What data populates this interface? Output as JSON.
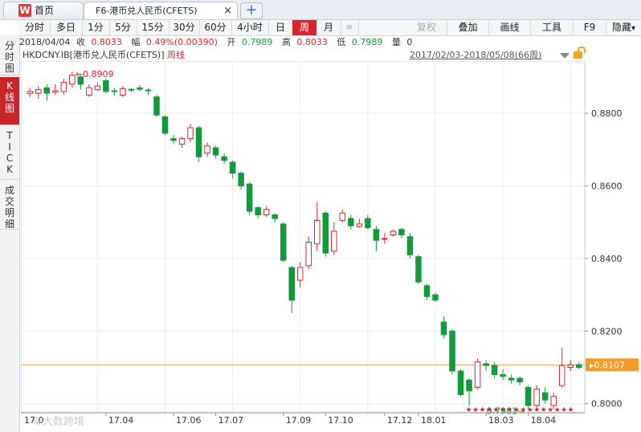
{
  "tabs": {
    "home": {
      "logo": "W",
      "label": "首页"
    },
    "active": {
      "label": "F6-港币兑人民币(CFETS)",
      "close": "×"
    },
    "new": "+"
  },
  "toolbar": {
    "items": [
      {
        "label": "分时"
      },
      {
        "label": "多日"
      },
      {
        "label": "1分"
      },
      {
        "label": "5分"
      },
      {
        "label": "15分"
      },
      {
        "label": "30分"
      },
      {
        "label": "60分"
      },
      {
        "label": "4小时"
      },
      {
        "label": "日"
      },
      {
        "label": "周",
        "selected": true
      },
      {
        "label": "月"
      },
      {
        "label": "≡",
        "icon": "list-icon"
      },
      {
        "label": "复权",
        "disabled": true
      },
      {
        "label": "叠加"
      },
      {
        "label": "画线"
      },
      {
        "label": "工具"
      },
      {
        "label": "F9"
      },
      {
        "label": "隐藏"
      }
    ],
    "dropdown_arrow": "▾"
  },
  "info": {
    "date": "2018/04/04",
    "close_label": "收",
    "close_value": "0.8033",
    "change_label": "幅",
    "change_value": "0.49%(0.00390)",
    "open_label": "开",
    "open_value": "0.7989",
    "high_label": "高",
    "high_value": "0.8033",
    "low_label": "低",
    "low_value": "0.7989",
    "vol_label": "量",
    "vol_value": "0"
  },
  "sidebar": {
    "items": [
      {
        "label": "分时图",
        "chars": [
          "分",
          "时",
          "图"
        ]
      },
      {
        "label": "K线图",
        "chars": [
          "K",
          "线",
          "图"
        ],
        "selected": true
      },
      {
        "label": "TICK",
        "chars": [
          "T",
          "I",
          "C",
          "K"
        ]
      },
      {
        "label": "成交明细",
        "chars": [
          "成",
          "交",
          "明",
          "细"
        ]
      }
    ]
  },
  "chart_title": {
    "code": "HKDCNY.IB",
    "name": "[港币兑人民币(CFETS)]",
    "period": "周线"
  },
  "range_text": "2017/02/03-2018/05/08(66周)",
  "watermark": "大数跨境",
  "colors": {
    "up": "#e0242a",
    "down": "#129b3c",
    "price_line": "#f0a25a",
    "accent": "#d9242a"
  },
  "chart_data": {
    "type": "candlestick",
    "y_ticks": [
      "0.8800",
      "0.8600",
      "0.8400",
      "0.8200",
      "0.8000"
    ],
    "y_tick_values": [
      0.88,
      0.86,
      0.84,
      0.82,
      0.8
    ],
    "ylim": [
      0.7975,
      0.8935
    ],
    "x_ticks": [
      {
        "label": "17.04",
        "index": 9
      },
      {
        "label": "17.06",
        "index": 17
      },
      {
        "label": "17.07",
        "index": 22
      },
      {
        "label": "17.09",
        "index": 30
      },
      {
        "label": "17.10",
        "index": 35
      },
      {
        "label": "17.12",
        "index": 42
      },
      {
        "label": "18.01",
        "index": 46
      },
      {
        "label": "18.03",
        "index": 54
      },
      {
        "label": "18.04",
        "index": 59
      }
    ],
    "x_tick_first": "17.0",
    "current_price": "0.8107",
    "current_price_value": 0.8107,
    "high_annotation": {
      "label": "←0.8909",
      "index": 5,
      "value": 0.8909
    },
    "low_annotation": {
      "label": "0.7981→",
      "index": 59,
      "value": 0.7981
    },
    "event_markers": "★★★★★★★★★★★★★★★★",
    "candles": [
      {
        "o": 0.8855,
        "c": 0.886,
        "h": 0.887,
        "l": 0.8845
      },
      {
        "o": 0.8855,
        "c": 0.8865,
        "h": 0.8875,
        "l": 0.884
      },
      {
        "o": 0.887,
        "c": 0.8855,
        "h": 0.888,
        "l": 0.8835
      },
      {
        "o": 0.8858,
        "c": 0.8862,
        "h": 0.888,
        "l": 0.885
      },
      {
        "o": 0.886,
        "c": 0.8885,
        "h": 0.8895,
        "l": 0.885
      },
      {
        "o": 0.888,
        "c": 0.8905,
        "h": 0.8915,
        "l": 0.887
      },
      {
        "o": 0.89,
        "c": 0.888,
        "h": 0.8905,
        "l": 0.8865
      },
      {
        "o": 0.885,
        "c": 0.887,
        "h": 0.888,
        "l": 0.8845
      },
      {
        "o": 0.8865,
        "c": 0.8875,
        "h": 0.8885,
        "l": 0.886
      },
      {
        "o": 0.889,
        "c": 0.886,
        "h": 0.8895,
        "l": 0.8855
      },
      {
        "o": 0.8862,
        "c": 0.886,
        "h": 0.887,
        "l": 0.8848
      },
      {
        "o": 0.885,
        "c": 0.8868,
        "h": 0.8875,
        "l": 0.8845
      },
      {
        "o": 0.8866,
        "c": 0.8864,
        "h": 0.887,
        "l": 0.8858
      },
      {
        "o": 0.887,
        "c": 0.8866,
        "h": 0.8878,
        "l": 0.886
      },
      {
        "o": 0.8864,
        "c": 0.8862,
        "h": 0.887,
        "l": 0.885
      },
      {
        "o": 0.8845,
        "c": 0.8795,
        "h": 0.885,
        "l": 0.879
      },
      {
        "o": 0.879,
        "c": 0.8745,
        "h": 0.8795,
        "l": 0.874
      },
      {
        "o": 0.873,
        "c": 0.8725,
        "h": 0.874,
        "l": 0.8715
      },
      {
        "o": 0.8715,
        "c": 0.873,
        "h": 0.8735,
        "l": 0.8705
      },
      {
        "o": 0.873,
        "c": 0.876,
        "h": 0.877,
        "l": 0.872
      },
      {
        "o": 0.876,
        "c": 0.868,
        "h": 0.8765,
        "l": 0.8665
      },
      {
        "o": 0.869,
        "c": 0.871,
        "h": 0.872,
        "l": 0.868
      },
      {
        "o": 0.8705,
        "c": 0.8685,
        "h": 0.871,
        "l": 0.8675
      },
      {
        "o": 0.868,
        "c": 0.867,
        "h": 0.869,
        "l": 0.866
      },
      {
        "o": 0.8665,
        "c": 0.8635,
        "h": 0.867,
        "l": 0.862
      },
      {
        "o": 0.8635,
        "c": 0.86,
        "h": 0.864,
        "l": 0.859
      },
      {
        "o": 0.8605,
        "c": 0.853,
        "h": 0.861,
        "l": 0.852
      },
      {
        "o": 0.854,
        "c": 0.852,
        "h": 0.8545,
        "l": 0.851
      },
      {
        "o": 0.852,
        "c": 0.8535,
        "h": 0.8545,
        "l": 0.8515
      },
      {
        "o": 0.852,
        "c": 0.851,
        "h": 0.8525,
        "l": 0.85
      },
      {
        "o": 0.8495,
        "c": 0.8395,
        "h": 0.85,
        "l": 0.839
      },
      {
        "o": 0.8375,
        "c": 0.8285,
        "h": 0.838,
        "l": 0.825
      },
      {
        "o": 0.834,
        "c": 0.8375,
        "h": 0.839,
        "l": 0.832
      },
      {
        "o": 0.838,
        "c": 0.8445,
        "h": 0.846,
        "l": 0.837
      },
      {
        "o": 0.844,
        "c": 0.8505,
        "h": 0.8555,
        "l": 0.842
      },
      {
        "o": 0.8525,
        "c": 0.8415,
        "h": 0.853,
        "l": 0.8405
      },
      {
        "o": 0.842,
        "c": 0.8475,
        "h": 0.85,
        "l": 0.841
      },
      {
        "o": 0.8505,
        "c": 0.8525,
        "h": 0.8535,
        "l": 0.85
      },
      {
        "o": 0.851,
        "c": 0.849,
        "h": 0.852,
        "l": 0.848
      },
      {
        "o": 0.8488,
        "c": 0.8495,
        "h": 0.851,
        "l": 0.8485
      },
      {
        "o": 0.851,
        "c": 0.8485,
        "h": 0.852,
        "l": 0.848
      },
      {
        "o": 0.848,
        "c": 0.845,
        "h": 0.849,
        "l": 0.842
      },
      {
        "o": 0.8455,
        "c": 0.8455,
        "h": 0.847,
        "l": 0.844
      },
      {
        "o": 0.8465,
        "c": 0.8475,
        "h": 0.848,
        "l": 0.846
      },
      {
        "o": 0.848,
        "c": 0.8465,
        "h": 0.8485,
        "l": 0.8455
      },
      {
        "o": 0.846,
        "c": 0.841,
        "h": 0.847,
        "l": 0.84
      },
      {
        "o": 0.8405,
        "c": 0.8335,
        "h": 0.841,
        "l": 0.833
      },
      {
        "o": 0.8325,
        "c": 0.8295,
        "h": 0.833,
        "l": 0.8285
      },
      {
        "o": 0.83,
        "c": 0.8285,
        "h": 0.8305,
        "l": 0.828
      },
      {
        "o": 0.8225,
        "c": 0.819,
        "h": 0.824,
        "l": 0.818
      },
      {
        "o": 0.82,
        "c": 0.809,
        "h": 0.8205,
        "l": 0.808
      },
      {
        "o": 0.809,
        "c": 0.8025,
        "h": 0.8095,
        "l": 0.802
      },
      {
        "o": 0.8065,
        "c": 0.8035,
        "h": 0.807,
        "l": 0.7995
      },
      {
        "o": 0.8045,
        "c": 0.8115,
        "h": 0.8125,
        "l": 0.804
      },
      {
        "o": 0.811,
        "c": 0.8105,
        "h": 0.812,
        "l": 0.809
      },
      {
        "o": 0.8105,
        "c": 0.808,
        "h": 0.8115,
        "l": 0.807
      },
      {
        "o": 0.808,
        "c": 0.8075,
        "h": 0.8095,
        "l": 0.8065
      },
      {
        "o": 0.807,
        "c": 0.8065,
        "h": 0.808,
        "l": 0.8055
      },
      {
        "o": 0.807,
        "c": 0.806,
        "h": 0.8075,
        "l": 0.805
      },
      {
        "o": 0.8045,
        "c": 0.7995,
        "h": 0.805,
        "l": 0.7985
      },
      {
        "o": 0.7995,
        "c": 0.804,
        "h": 0.805,
        "l": 0.7985
      },
      {
        "o": 0.803,
        "c": 0.801,
        "h": 0.8045,
        "l": 0.8
      },
      {
        "o": 0.7995,
        "c": 0.802,
        "h": 0.803,
        "l": 0.7985
      },
      {
        "o": 0.805,
        "c": 0.8105,
        "h": 0.8155,
        "l": 0.8045
      },
      {
        "o": 0.81,
        "c": 0.8107,
        "h": 0.812,
        "l": 0.809
      },
      {
        "o": 0.8107,
        "c": 0.81,
        "h": 0.8115,
        "l": 0.8095
      }
    ]
  }
}
